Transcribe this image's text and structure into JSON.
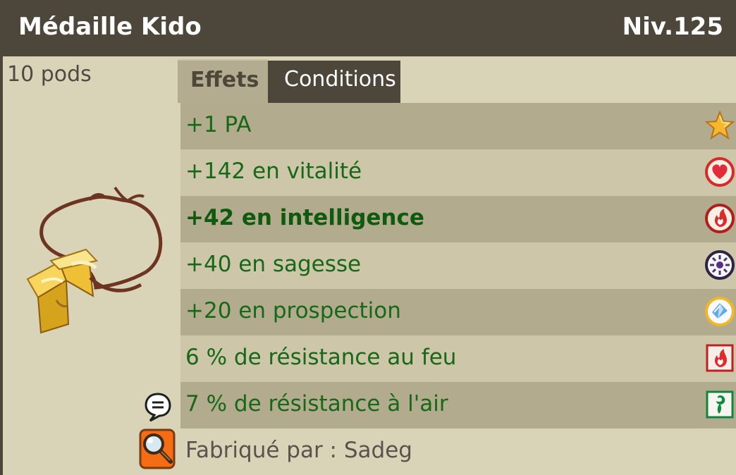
{
  "item": {
    "name": "Médaille Kido",
    "level": "Niv.125",
    "weight": "10 pods",
    "image_icon": "medal-necklace-icon"
  },
  "tabs": [
    {
      "label": "Effets",
      "active": true
    },
    {
      "label": "Conditions",
      "active": false
    }
  ],
  "effects": [
    {
      "text": "+1 PA",
      "icon": "star-icon",
      "bold": false
    },
    {
      "text": "+142 en vitalité",
      "icon": "heart-icon",
      "bold": false
    },
    {
      "text": "+42 en intelligence",
      "icon": "fire-icon",
      "bold": true
    },
    {
      "text": "+40 en sagesse",
      "icon": "wisdom-icon",
      "bold": false
    },
    {
      "text": "+20 en prospection",
      "icon": "prospecting-icon",
      "bold": false
    },
    {
      "text": "6 % de résistance au feu",
      "icon": "fire-resistance-icon",
      "bold": false
    },
    {
      "text": "7 % de résistance à l'air",
      "icon": "air-resistance-icon",
      "bold": false
    }
  ],
  "crafter": {
    "text": "Fabriqué par : Sadeg"
  },
  "actions": {
    "chat_icon": "speech-bubble-icon",
    "inspect_icon": "magnifier-icon"
  },
  "colors": {
    "titlebar": "#4c463b",
    "effect_text": "#176817",
    "panel": "#d9d4b8"
  }
}
